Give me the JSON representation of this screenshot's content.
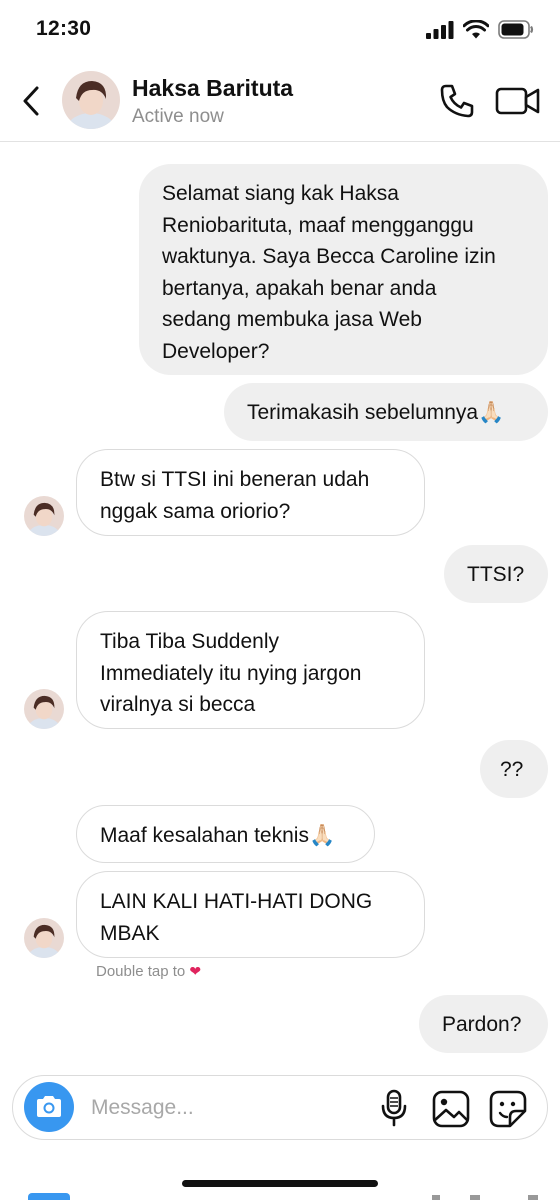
{
  "status_bar": {
    "time": "12:30"
  },
  "header": {
    "contact_name": "Haksa Barituta",
    "contact_status": "Active now"
  },
  "messages": [
    {
      "direction": "outgoing",
      "text": "Selamat siang kak Haksa\nReniobarituta, maaf mengganggu\nwaktunya. Saya Becca Caroline izin\nbertanya, apakah benar anda\nsedang membuka jasa Web\nDeveloper?"
    },
    {
      "direction": "outgoing",
      "text": "Terimakasih sebelumnya🙏🏻"
    },
    {
      "direction": "incoming",
      "text": "Btw si TTSI ini beneran udah\nnggak sama oriorio?"
    },
    {
      "direction": "outgoing",
      "text": "TTSI?"
    },
    {
      "direction": "incoming",
      "text": "Tiba Tiba Suddenly\nImmediately itu nying jargon\nviralnya si becca"
    },
    {
      "direction": "outgoing",
      "text": "??"
    },
    {
      "direction": "incoming",
      "text": "Maaf kesalahan teknis🙏🏻"
    },
    {
      "direction": "incoming",
      "text": "LAIN KALI HATI-HATI DONG\nMBAK"
    },
    {
      "direction": "outgoing",
      "text": "Pardon?"
    }
  ],
  "double_tap_hint": "Double tap to",
  "composer": {
    "placeholder": "Message..."
  },
  "colors": {
    "accent_blue": "#3897f0",
    "outgoing_bubble": "#efefef",
    "incoming_border": "#dbdbdb",
    "secondary_text": "#8e8e8e",
    "heart": "#e0245e"
  },
  "icons": {
    "back": "chevron-left-icon",
    "call": "phone-icon",
    "video": "video-camera-icon",
    "camera": "camera-icon",
    "mic": "microphone-icon",
    "gallery": "image-icon",
    "sticker": "sticker-icon"
  }
}
